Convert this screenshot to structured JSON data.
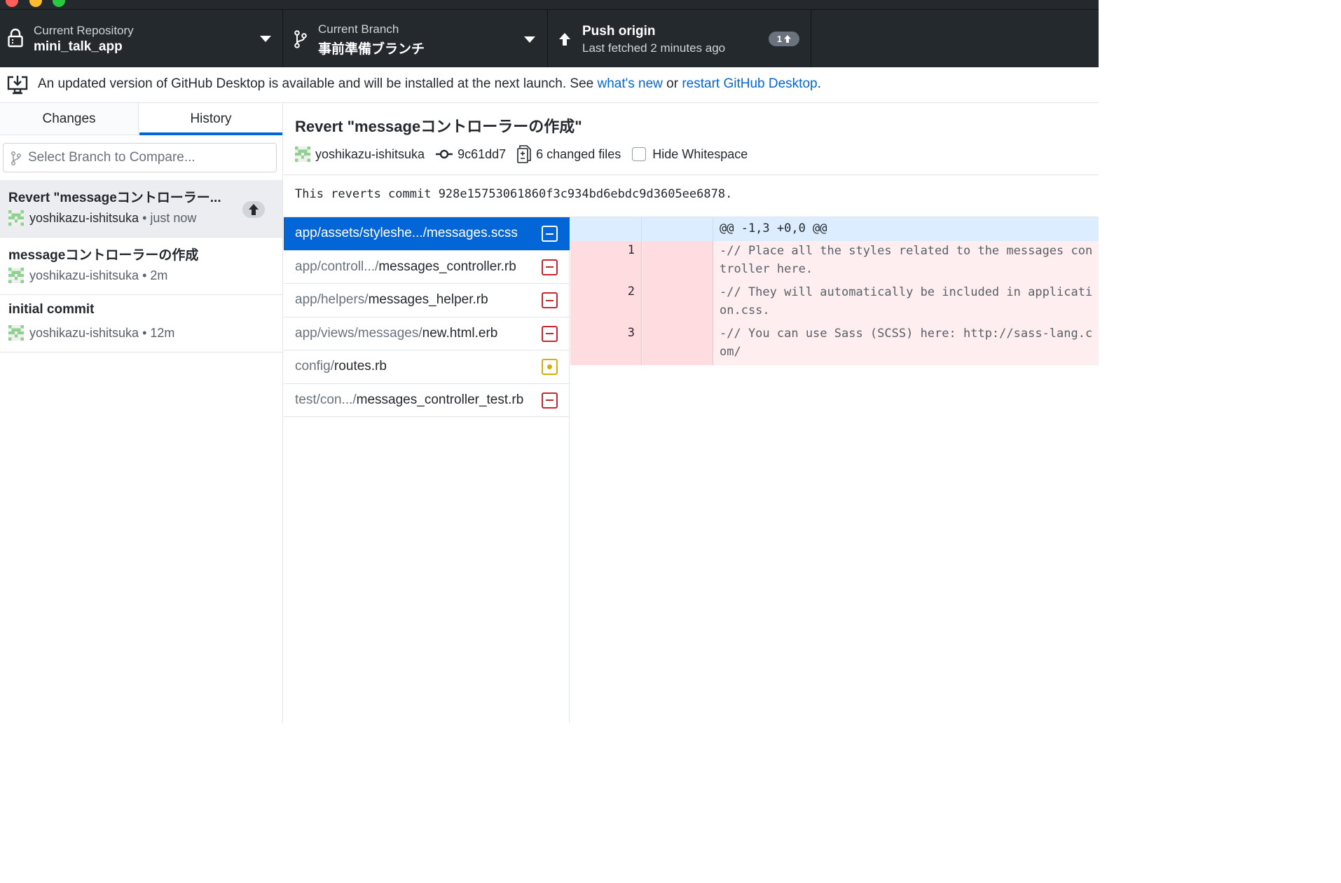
{
  "toolbar": {
    "repository_label": "Current Repository",
    "repository_name": "mini_talk_app",
    "branch_label": "Current Branch",
    "branch_name": "事前準備ブランチ",
    "push_title": "Push origin",
    "push_subtitle": "Last fetched 2 minutes ago",
    "push_count": "1"
  },
  "banner": {
    "text": "An updated version of GitHub Desktop is available and will be installed at the next launch. See ",
    "link_whats_new": "what's new",
    "or": " or ",
    "link_restart": "restart GitHub Desktop",
    "period": "."
  },
  "tabs": {
    "changes": "Changes",
    "history": "History",
    "active": "History"
  },
  "compare": {
    "placeholder": "Select Branch to Compare..."
  },
  "commits": [
    {
      "summary": "Revert \"messageコントローラー...",
      "author": "yoshikazu-ishitsuka",
      "time": "• just now",
      "unpushed": true
    },
    {
      "summary": "messageコントローラーの作成",
      "author": "yoshikazu-ishitsuka",
      "time": "• 2m"
    },
    {
      "summary": "initial commit",
      "author": "yoshikazu-ishitsuka",
      "time": "• 12m"
    }
  ],
  "commit_detail": {
    "title": "Revert \"messageコントローラーの作成\"",
    "author": "yoshikazu-ishitsuka",
    "sha": "9c61dd7",
    "changed_files": "6 changed files",
    "hide_whitespace": "Hide Whitespace",
    "hide_whitespace_checked": false,
    "description": "This reverts commit 928e15753061860f3c934bd6ebdc9d3605ee6878."
  },
  "files": [
    {
      "dir": "app/assets/styleshe.../",
      "name": "messages.scss",
      "status": "deleted",
      "selected": true
    },
    {
      "dir": "app/controll.../",
      "name": "messages_controller.rb",
      "status": "deleted"
    },
    {
      "dir": "app/helpers/",
      "name": "messages_helper.rb",
      "status": "deleted"
    },
    {
      "dir": "app/views/messages/",
      "name": "new.html.erb",
      "status": "deleted"
    },
    {
      "dir": "config/",
      "name": "routes.rb",
      "status": "modified"
    },
    {
      "dir": "test/con.../",
      "name": "messages_controller_test.rb",
      "status": "deleted"
    }
  ],
  "diff": {
    "hunk_header": "@@ -1,3 +0,0 @@",
    "lines": [
      {
        "num": "1",
        "text": "-// Place all the styles related to the messages controller here."
      },
      {
        "num": "2",
        "text": "-// They will automatically be included in application.css."
      },
      {
        "num": "3",
        "text": "-// You can use Sass (SCSS) here: http://sass-lang.com/"
      }
    ]
  },
  "colors": {
    "toolbar_bg": "#24292e",
    "accent_blue": "#0366d6",
    "deleted_red": "#cb2431",
    "modified_yellow": "#dbab09",
    "diff_deleted_bg": "#ffeef0",
    "hunk_bg": "#dbedff"
  },
  "icons": [
    "lock-icon",
    "caret-down-icon",
    "git-branch-icon",
    "arrow-up-icon",
    "desktop-download-icon",
    "git-commit-icon",
    "diff-icon",
    "avatar-identicon"
  ]
}
